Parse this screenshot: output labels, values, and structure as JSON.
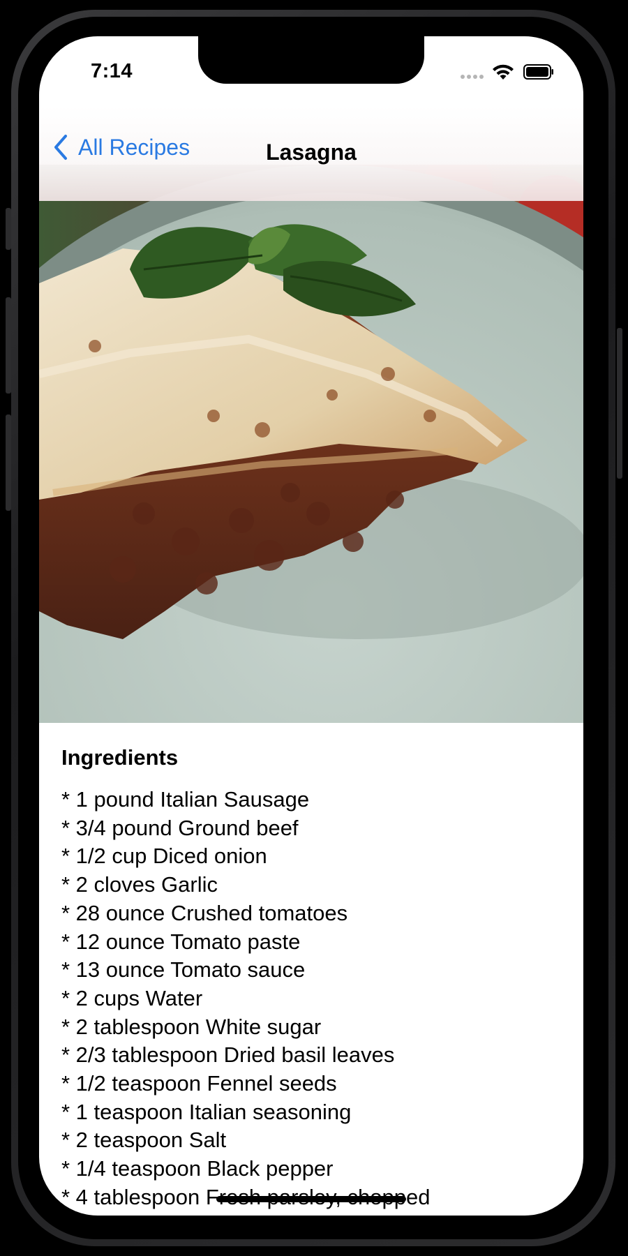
{
  "status_bar": {
    "time": "7:14"
  },
  "nav": {
    "back_label": "All Recipes",
    "title": "Lasagna"
  },
  "hero": {
    "description": "lasagna on plate with basil"
  },
  "ingredients": {
    "heading": "Ingredients",
    "items": [
      "* 1 pound Italian Sausage",
      "* 3/4 pound Ground beef",
      "* 1/2 cup Diced onion",
      "* 2 cloves Garlic",
      "* 28 ounce Crushed tomatoes",
      "* 12 ounce Tomato paste",
      "* 13 ounce Tomato sauce",
      "* 2 cups Water",
      "* 2 tablespoon White sugar",
      "* 2/3 tablespoon Dried basil leaves",
      "* 1/2 teaspoon Fennel seeds",
      "* 1 teaspoon Italian seasoning",
      "* 2 teaspoon Salt",
      "* 1/4 teaspoon Black pepper",
      "* 4 tablespoon Fresh parsley, chopped"
    ]
  },
  "colors": {
    "accent": "#2a7ae2",
    "plate": "#b7c7c0",
    "sauce": "#6b2f1c",
    "cheese": "#e8dcc3",
    "basil": "#2f5a22"
  }
}
